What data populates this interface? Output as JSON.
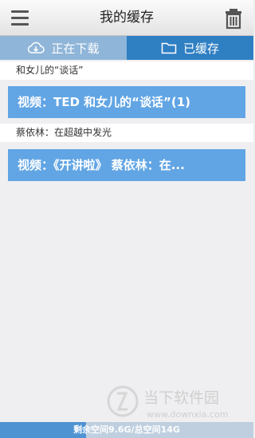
{
  "header": {
    "title": "我的缓存"
  },
  "tabs": [
    {
      "label": "正在下载",
      "icon": "cloud-download-icon"
    },
    {
      "label": "已缓存",
      "icon": "folder-icon"
    }
  ],
  "groups": [
    {
      "label": "和女儿的“谈话”",
      "items": [
        "视频：TED 和女儿的“谈话”(1)"
      ]
    },
    {
      "label": "蔡依林：在超越中发光",
      "items": [
        "视频：《开讲啦》 蔡依林：在..."
      ]
    }
  ],
  "storage": {
    "text": "剩余空间9.6G/总空间14G",
    "used_fraction": 0.34
  },
  "watermark": {
    "brand": "当下软件园",
    "url": "www.downxia.com"
  },
  "colors": {
    "tab_active": "#2f7fc3",
    "tab_inactive": "#8fb5d8",
    "item_bg": "#62a5e4"
  }
}
